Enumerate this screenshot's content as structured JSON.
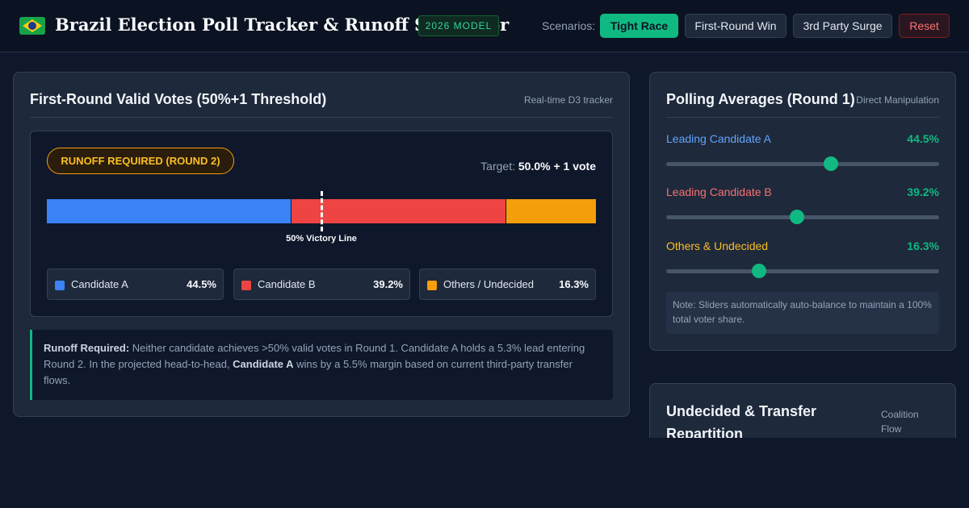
{
  "header": {
    "title": "Brazil Election Poll Tracker & Runoff Simulator",
    "model_badge": "2026 MODEL",
    "scenarios_label": "Scenarios:",
    "buttons": [
      "Tight Race",
      "First-Round Win",
      "3rd Party Surge",
      "Reset"
    ],
    "flag_icon": "brazil-flag-icon"
  },
  "colors": {
    "candidate_a": "#3b82f6",
    "candidate_b": "#ef4444",
    "others": "#f59e0b",
    "accent": "#10b981"
  },
  "first_round": {
    "title": "First-Round Valid Votes (50%+1 Threshold)",
    "subtitle": "Real-time D3 tracker",
    "status_badge": "RUNOFF REQUIRED (ROUND 2)",
    "target_label": "Target:",
    "target_value": "50.0% + 1 vote",
    "victory_label": "50% Victory Line",
    "victory_threshold": 50,
    "shares": [
      {
        "label": "Candidate A",
        "value": 44.5,
        "display": "44.5%"
      },
      {
        "label": "Candidate B",
        "value": 39.2,
        "display": "39.2%"
      },
      {
        "label": "Others / Undecided",
        "value": 16.3,
        "display": "16.3%"
      }
    ]
  },
  "summary": {
    "heading": "Runoff Required:",
    "text1": " Neither candidate achieves >50% valid votes in Round 1. Candidate A holds a 5.3% lead entering Round 2. In the projected head-to-head, ",
    "winner": "Candidate A",
    "text2": " wins by a 5.5% margin based on current third-party transfer flows."
  },
  "polling": {
    "title": "Polling Averages (Round 1)",
    "subtitle": "Direct Manipulation",
    "sliders": [
      {
        "label": "Leading Candidate A",
        "value": 44.5,
        "display": "44.5%",
        "level": 0.605
      },
      {
        "label": "Leading Candidate B",
        "value": 39.2,
        "display": "39.2%",
        "level": 0.48
      },
      {
        "label": "Others & Undecided",
        "value": 16.3,
        "display": "16.3%",
        "level": 0.34
      }
    ],
    "note": "Note: Sliders automatically auto-balance to maintain a 100% total voter share."
  },
  "transfer": {
    "title": "Undecided & Transfer Repartition",
    "subtitle": "Coalition Flow"
  }
}
